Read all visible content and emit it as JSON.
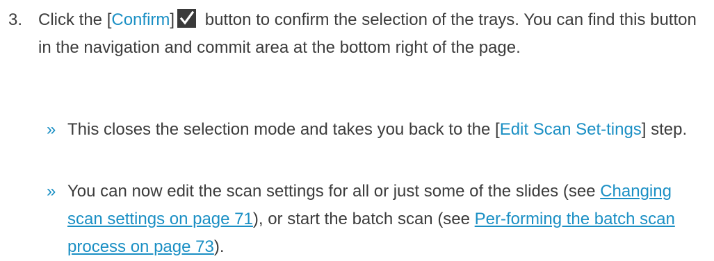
{
  "step": {
    "number": "3.",
    "text_before": "Click the [",
    "confirm_label": "Confirm",
    "text_after_bracket": "]",
    "icon": "checkmark-icon",
    "text_after_icon": " button to confirm the selection of the trays. You can find this button in the navigation and commit area at the bottom right of the page."
  },
  "results": [
    {
      "marker": "»",
      "text_before": "This closes the selection mode and takes you back to the [",
      "ui_ref": "Edit Scan Set-tings",
      "text_after": "] step."
    },
    {
      "marker": "»",
      "text_before": "You can now edit the scan settings for all or just some of the slides (see ",
      "link1": "Changing scan settings on page 71",
      "text_middle": "), or start the batch scan (see ",
      "link2": "Per-forming the batch scan process on page 73",
      "text_after": ")."
    }
  ],
  "colors": {
    "text": "#3c3c3c",
    "accent": "#1a8fc4",
    "icon_bg": "#3a3a3a"
  }
}
